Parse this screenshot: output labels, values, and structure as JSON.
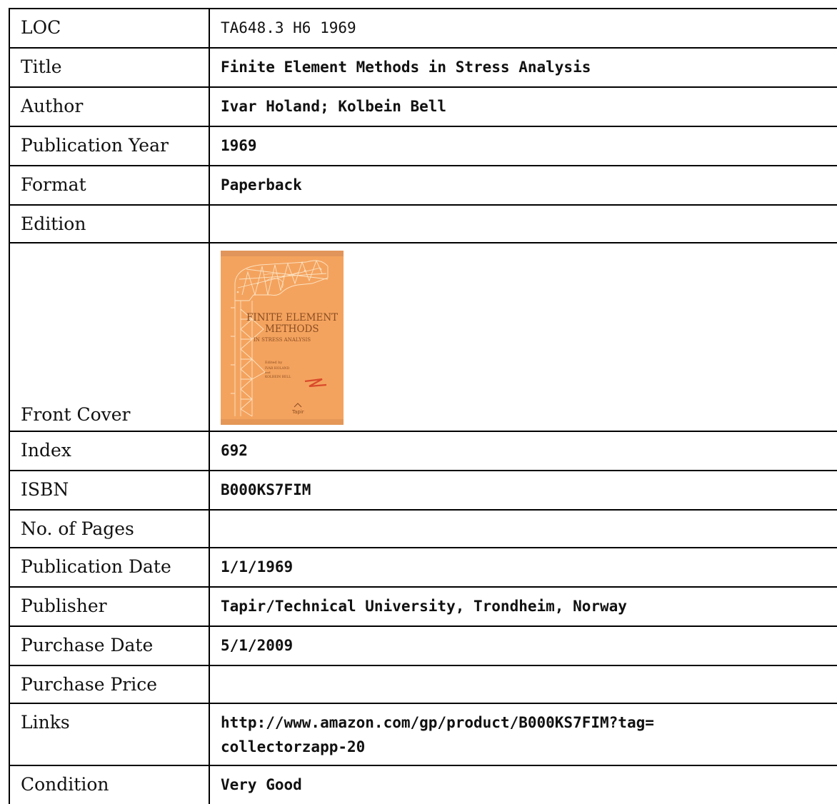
{
  "record": {
    "loc": {
      "label": "LOC",
      "value": "TA648.3 H6 1969"
    },
    "title": {
      "label": "Title",
      "value": "Finite Element Methods in Stress Analysis"
    },
    "author": {
      "label": "Author",
      "value": "Ivar Holand; Kolbein Bell"
    },
    "publication_year": {
      "label": "Publication Year",
      "value": "1969"
    },
    "format": {
      "label": "Format",
      "value": "Paperback"
    },
    "edition": {
      "label": "Edition",
      "value": ""
    },
    "front_cover": {
      "label": "Front Cover",
      "cover_title_line1": "FINITE ELEMENT",
      "cover_title_line2": "METHODS",
      "cover_subtitle": "IN STRESS ANALYSIS",
      "cover_edited_by": "Edited by",
      "cover_editor1": "IVAR HOLAND",
      "cover_and": "and",
      "cover_editor2": "KOLBEIN BELL",
      "cover_publisher": "Tapir",
      "cover_color": "#f4a35e",
      "cover_line_color": "#fbe3c4",
      "cover_text_color": "#8a4d22"
    },
    "index": {
      "label": "Index",
      "value": "692"
    },
    "isbn": {
      "label": "ISBN",
      "value": "B000KS7FIM"
    },
    "pages": {
      "label": "No. of Pages",
      "value": ""
    },
    "publication_date": {
      "label": "Publication Date",
      "value": "1/1/1969"
    },
    "publisher": {
      "label": "Publisher",
      "value": "Tapir/Technical University, Trondheim, Norway"
    },
    "purchase_date": {
      "label": "Purchase Date",
      "value": "5/1/2009"
    },
    "purchase_price": {
      "label": "Purchase Price",
      "value": ""
    },
    "links": {
      "label": "Links",
      "value_line1": "http://www.amazon.com/gp/product/B000KS7FIM?tag=",
      "value_line2": "collectorzapp-20"
    },
    "condition": {
      "label": "Condition",
      "value": "Very Good"
    }
  }
}
